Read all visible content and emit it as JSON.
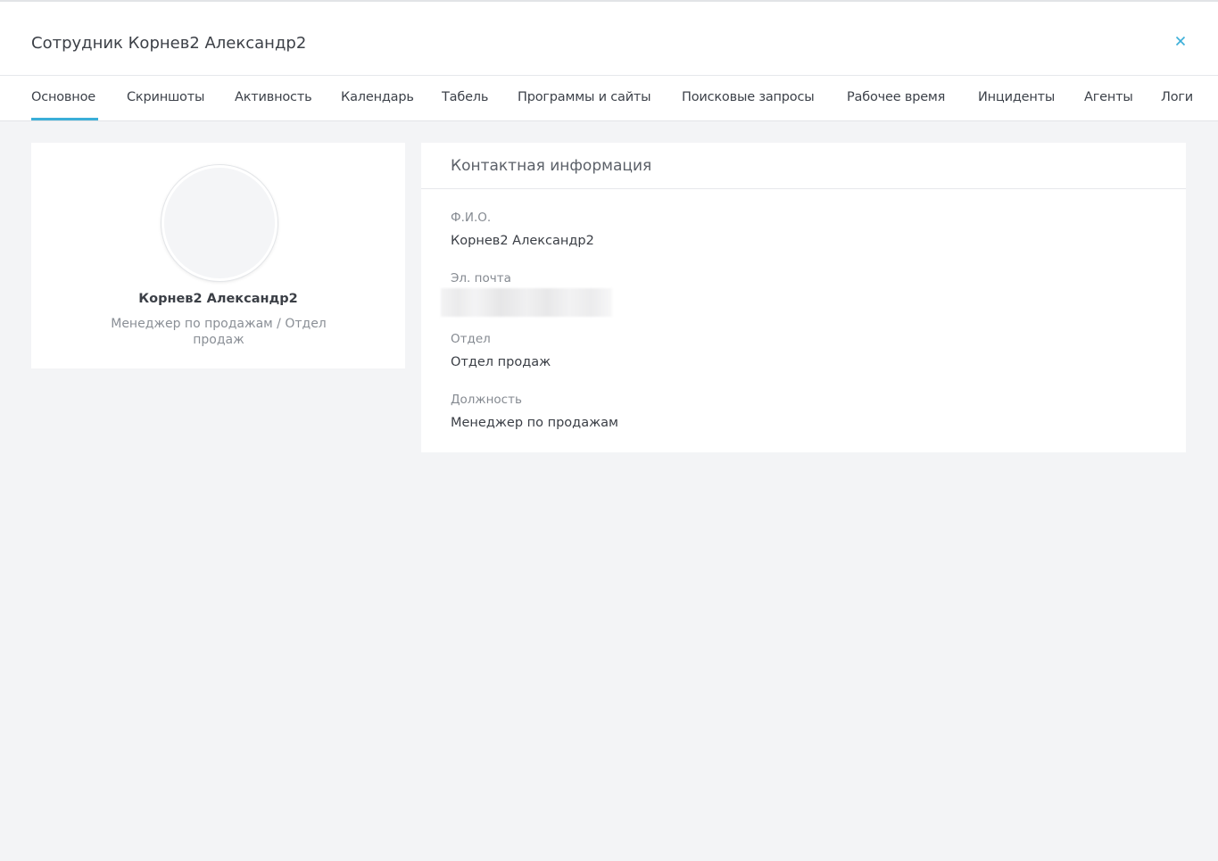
{
  "header": {
    "title": "Сотрудник Корнев2 Александр2",
    "close_label": "×"
  },
  "tabs": [
    {
      "label": "Основное",
      "active": true
    },
    {
      "label": "Скриншоты",
      "active": false
    },
    {
      "label": "Активность",
      "active": false
    },
    {
      "label": "Календарь",
      "active": false
    },
    {
      "label": "Табель",
      "active": false
    },
    {
      "label": "Программы и сайты",
      "active": false
    },
    {
      "label": "Поисковые запросы",
      "active": false
    },
    {
      "label": "Рабочее время",
      "active": false
    },
    {
      "label": "Инциденты",
      "active": false
    },
    {
      "label": "Агенты",
      "active": false
    },
    {
      "label": "Логи",
      "active": false
    }
  ],
  "profile": {
    "name": "Корнев2 Александр2",
    "role": "Менеджер по продажам / Отдел продаж"
  },
  "contact": {
    "title": "Контактная информация",
    "fields": [
      {
        "label": "Ф.И.О.",
        "value": "Корнев2 Александр2"
      },
      {
        "label": "Эл. почта",
        "value": ""
      },
      {
        "label": "Отдел",
        "value": "Отдел продаж"
      },
      {
        "label": "Должность",
        "value": "Менеджер по продажам"
      }
    ]
  },
  "colors": {
    "accent": "#3aaed8",
    "background": "#f3f4f6",
    "card": "#ffffff"
  }
}
